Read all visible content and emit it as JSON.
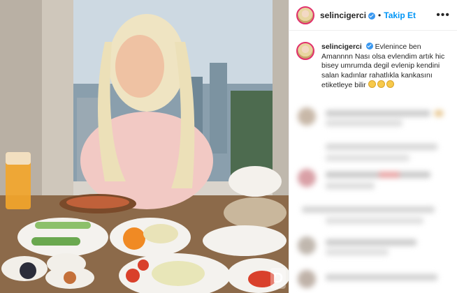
{
  "post": {
    "username": "selincigerci",
    "follow_label": "Takip Et",
    "separator": "•",
    "more_label": "•••"
  },
  "caption": {
    "username": "selincigerci",
    "text": "Evlenince ben Amannnn Nası olsa evlendim artık hic bisey umrumda degil evlenip kendini salan kadınlar rahatlıkla kankasını etiketleye bilir",
    "emoji": "grinning-sweat-emoji"
  },
  "colors": {
    "accent": "#0095f6",
    "verified": "#3897f0",
    "story_ring": "#e1306c"
  }
}
